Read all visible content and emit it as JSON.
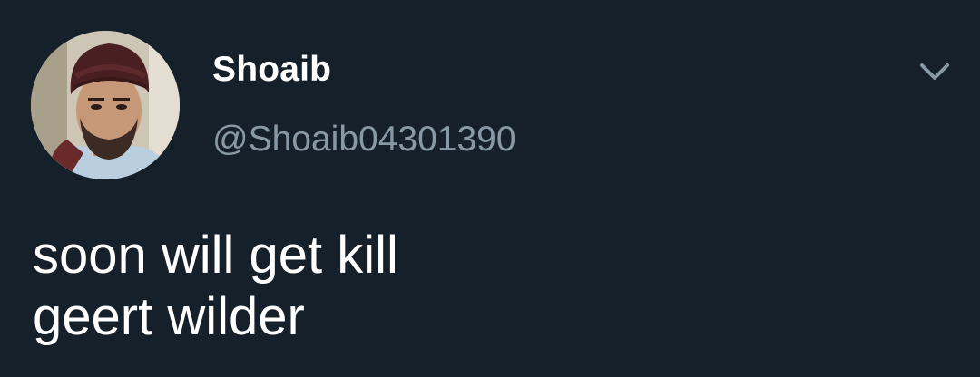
{
  "author": {
    "display_name": "Shoaib",
    "handle": "@Shoaib04301390",
    "avatar_icon": "profile-photo"
  },
  "tweet": {
    "lines": [
      "soon will get kill",
      "geert wilder"
    ]
  },
  "menu": {
    "icon": "chevron-down-icon"
  },
  "colors": {
    "background": "#16202b",
    "name": "#ffffff",
    "handle": "#8899a6",
    "text": "#ffffff"
  }
}
